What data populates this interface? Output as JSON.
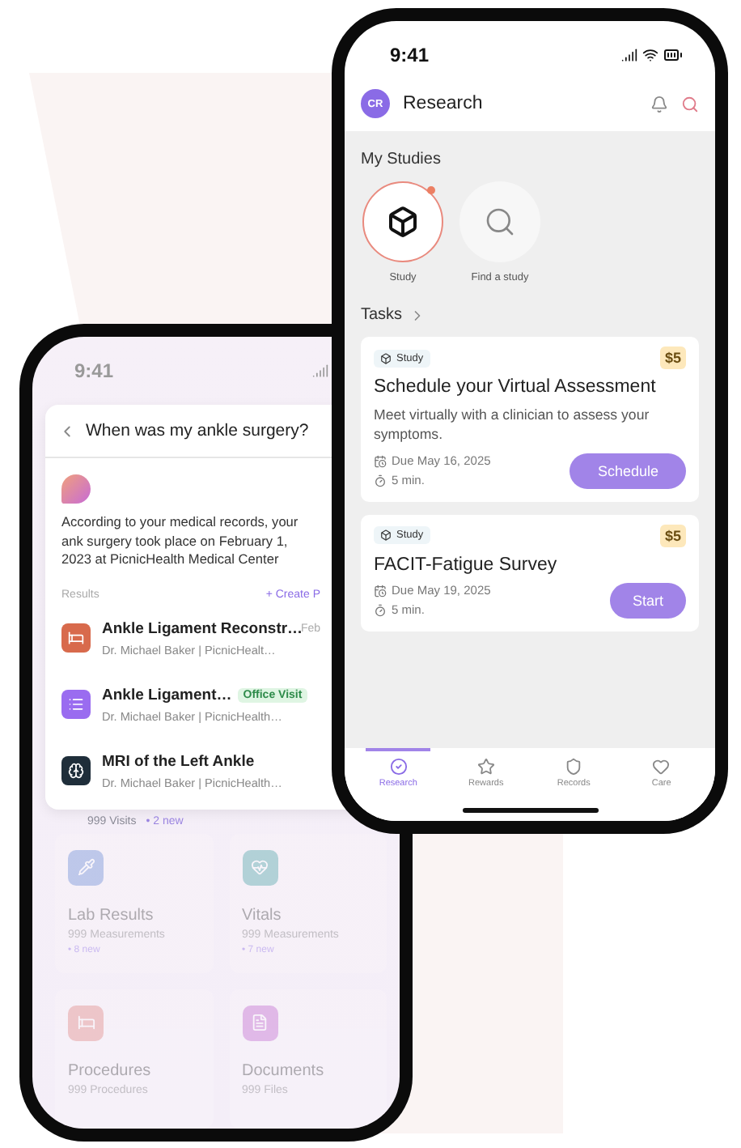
{
  "back_phone": {
    "status_time": "9:41",
    "chat": {
      "question": "When was my ankle surgery?",
      "answer": "According to your medical records, your ank surgery took place on February 1, 2023 at PicnicHealth Medical Center",
      "results_label": "Results",
      "create_action": "+ Create P",
      "results": [
        {
          "kind": "procedure",
          "title": "Ankle Ligament Reconstr…",
          "subtitle": "Dr. Michael Baker | PicnicHealt…",
          "date": "Feb"
        },
        {
          "kind": "visit",
          "title": "Ankle Ligament…",
          "tag": "Office Visit",
          "subtitle": "Dr. Michael Baker | PicnicHealth…"
        },
        {
          "kind": "imaging",
          "title": "MRI of the Left Ankle",
          "subtitle": "Dr. Michael Baker | PicnicHealth…"
        }
      ]
    },
    "visits_peek": {
      "count": "999 Visits",
      "new": "• 2 new"
    },
    "categories": [
      {
        "kind": "lab",
        "title": "Lab Results",
        "count": "999 Measurements",
        "new": "• 8 new"
      },
      {
        "kind": "vitals",
        "title": "Vitals",
        "count": "999 Measurements",
        "new": "• 7 new"
      },
      {
        "kind": "procedures",
        "title": "Procedures",
        "count": "999 Procedures"
      },
      {
        "kind": "documents",
        "title": "Documents",
        "count": "999 Files"
      }
    ]
  },
  "front_phone": {
    "status_time": "9:41",
    "header": {
      "avatar": "CR",
      "title": "Research"
    },
    "studies": {
      "title": "My Studies",
      "items": [
        {
          "kind": "study",
          "label": "Study",
          "selected": true
        },
        {
          "kind": "find",
          "label": "Find a study",
          "selected": false
        }
      ]
    },
    "tasks": {
      "title": "Tasks",
      "items": [
        {
          "tag": "Study",
          "reward": "$5",
          "title": "Schedule your Virtual Assessment",
          "description": "Meet virtually with a clinician to assess your symptoms.",
          "due": "Due May 16, 2025",
          "duration": "5 min.",
          "action": "Schedule"
        },
        {
          "tag": "Study",
          "reward": "$5",
          "title": "FACIT-Fatigue Survey",
          "due": "Due May 19, 2025",
          "duration": "5 min.",
          "action": "Start"
        }
      ]
    },
    "nav": [
      {
        "kind": "research",
        "label": "Research",
        "selected": true
      },
      {
        "kind": "rewards",
        "label": "Rewards",
        "selected": false
      },
      {
        "kind": "records",
        "label": "Records",
        "selected": false
      },
      {
        "kind": "care",
        "label": "Care",
        "selected": false
      }
    ]
  }
}
